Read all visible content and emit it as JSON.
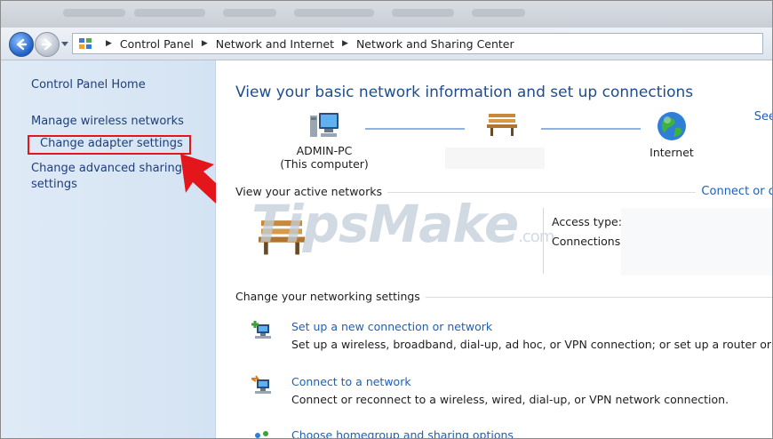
{
  "address_bar": {
    "crumbs": [
      "Control Panel",
      "Network and Internet",
      "Network and Sharing Center"
    ]
  },
  "left_pane": {
    "home": "Control Panel Home",
    "wireless": "Manage wireless networks",
    "adapter": "Change adapter settings",
    "advanced": "Change advanced sharing settings"
  },
  "main": {
    "heading": "View your basic network information and set up connections",
    "see_link": "See",
    "map": {
      "computer_name": "ADMIN-PC",
      "computer_note": "(This computer)",
      "internet": "Internet"
    },
    "active_networks": {
      "label": "View your active networks",
      "connect_link": "Connect or d",
      "access_type_label": "Access type:",
      "connections_label": "Connections:"
    },
    "watermark": {
      "main": "TipsMake",
      "suffix": ".com"
    },
    "settings": {
      "label": "Change your networking settings",
      "tasks": [
        {
          "link": "Set up a new connection or network",
          "desc": "Set up a wireless, broadband, dial-up, ad hoc, or VPN connection; or set up a router or acce"
        },
        {
          "link": "Connect to a network",
          "desc": "Connect or reconnect to a wireless, wired, dial-up, or VPN network connection."
        },
        {
          "link": "Choose homegroup and sharing options",
          "desc": ""
        }
      ]
    }
  },
  "colors": {
    "highlight": "#e3161c",
    "link": "#1e5fb8",
    "heading": "#1e4d8c",
    "left_pane": "#dfeaf6"
  },
  "icons": [
    "back-arrow-icon",
    "forward-arrow-icon",
    "control-panel-icon",
    "computer-icon",
    "bench-icon",
    "globe-icon",
    "new-connection-icon",
    "connect-network-icon",
    "homegroup-icon",
    "red-arrow-icon"
  ]
}
